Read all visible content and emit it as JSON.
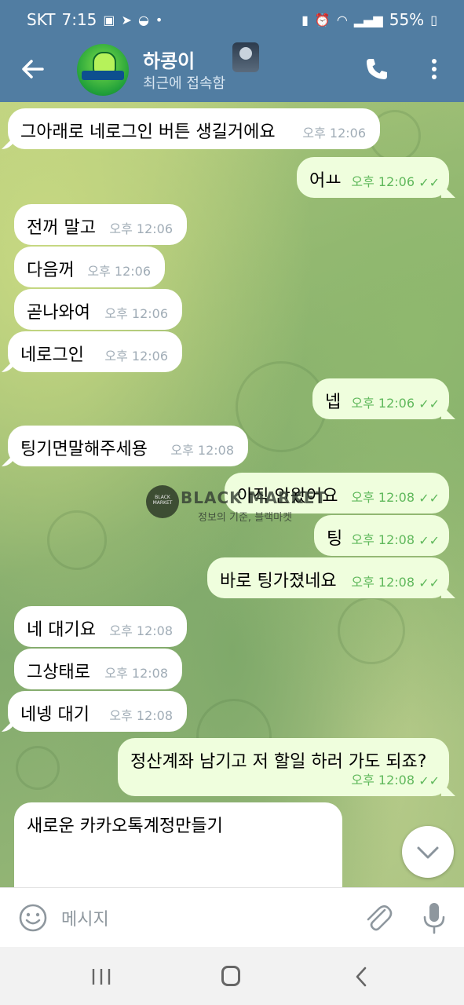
{
  "status_bar": {
    "carrier": "SKT",
    "time": "7:15",
    "battery": "55%"
  },
  "header": {
    "title": "하콩이",
    "subtitle": "최근에 접속함"
  },
  "messages": [
    {
      "dir": "in",
      "text": "그아래로 네로그인 버튼 생길거에요",
      "time": "오후 12:06"
    },
    {
      "dir": "out",
      "text": "어ㅛ",
      "time": "오후 12:06"
    },
    {
      "dir": "in",
      "text": "전꺼 말고",
      "time": "오후 12:06"
    },
    {
      "dir": "in",
      "text": "다음꺼",
      "time": "오후 12:06"
    },
    {
      "dir": "in",
      "text": "곧나와여",
      "time": "오후 12:06"
    },
    {
      "dir": "in",
      "text": "네로그인",
      "time": "오후 12:06"
    },
    {
      "dir": "out",
      "text": "넵",
      "time": "오후 12:06"
    },
    {
      "dir": "in",
      "text": "팅기면말해주세용",
      "time": "오후 12:08"
    },
    {
      "dir": "out",
      "text": "아직 안왔어요",
      "time": "오후 12:08"
    },
    {
      "dir": "out",
      "text": "팅",
      "time": "오후 12:08"
    },
    {
      "dir": "out",
      "text": "바로 팅가졌네요",
      "time": "오후 12:08"
    },
    {
      "dir": "in",
      "text": "네 대기요",
      "time": "오후 12:08"
    },
    {
      "dir": "in",
      "text": "그상태로",
      "time": "오후 12:08"
    },
    {
      "dir": "in",
      "text": "네넹 대기",
      "time": "오후 12:08"
    },
    {
      "dir": "out",
      "text": "정산계좌 남기고 저 할일 하러 가도 되죠?",
      "time": "오후 12:08"
    },
    {
      "dir": "in",
      "text": "새로운 카카오톡계정만들기",
      "time": ""
    }
  ],
  "watermark": {
    "logo_text": "BLACK MARKET",
    "title": "BLACK MARKET",
    "subtitle": "정보의 기준, 블랙마켓"
  },
  "input": {
    "placeholder": "메시지"
  },
  "colors": {
    "header": "#517da2",
    "outgoing_bubble": "#effedd",
    "incoming_bubble": "#ffffff",
    "read_check": "#5fb85b"
  }
}
